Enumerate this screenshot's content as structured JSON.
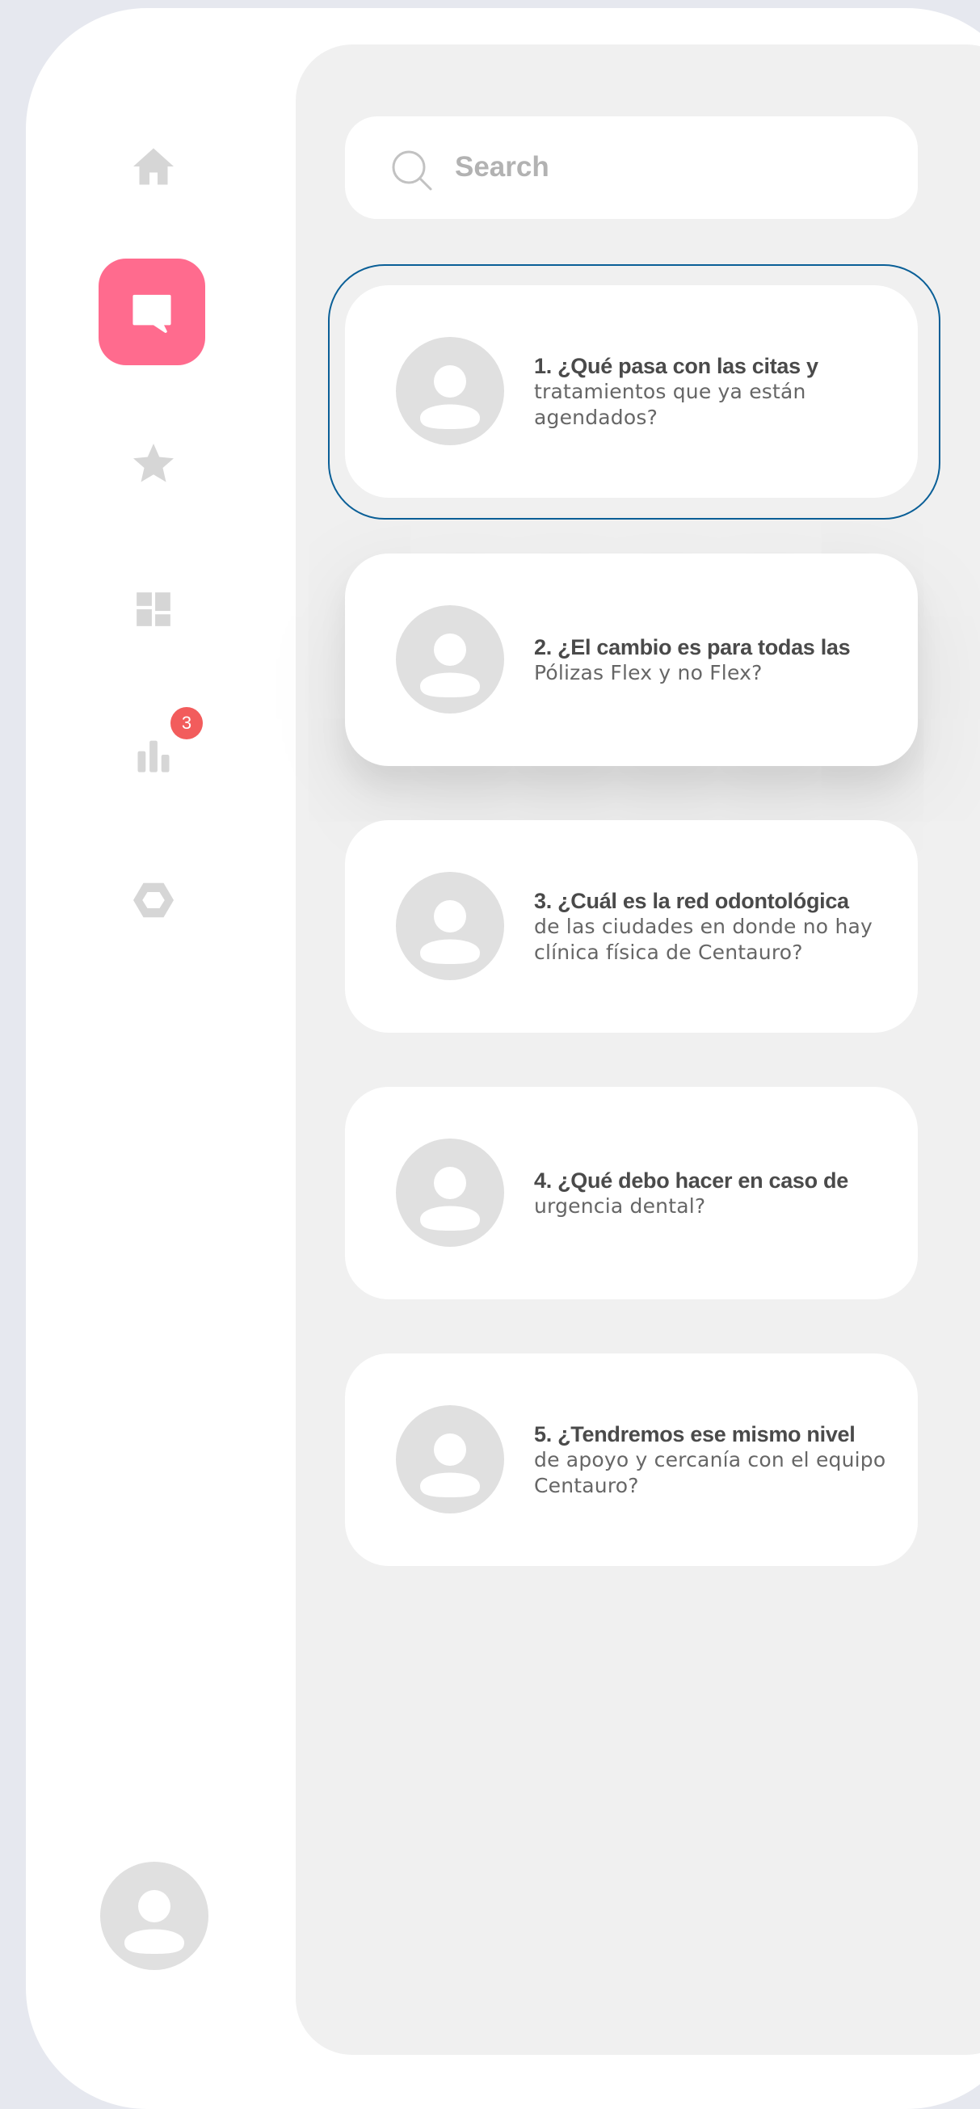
{
  "search": {
    "placeholder": "Search",
    "value": ""
  },
  "sidebar": {
    "items": [
      {
        "name": "home",
        "icon": "home-icon",
        "active": false
      },
      {
        "name": "messages",
        "icon": "message-icon",
        "active": true
      },
      {
        "name": "favorites",
        "icon": "star-icon",
        "active": false
      },
      {
        "name": "dashboard",
        "icon": "dashboard-icon",
        "active": false
      },
      {
        "name": "stats",
        "icon": "bar-chart-icon",
        "active": false,
        "badge": "3"
      },
      {
        "name": "settings",
        "icon": "hexagon-icon",
        "active": false
      }
    ],
    "badge_count": "3"
  },
  "questions": [
    {
      "title": "1. ¿Qué pasa con las citas y",
      "body": "tratamientos que ya están agendados?",
      "focused": true
    },
    {
      "title": "2. ¿El cambio es para todas las",
      "body": "Pólizas Flex y no Flex?",
      "hovered": true
    },
    {
      "title": "3. ¿Cuál es la red odontológica",
      "body": "de las ciudades en donde no hay clínica física de Centauro?"
    },
    {
      "title": "4. ¿Qué debo hacer en caso de",
      "body": "urgencia dental?"
    },
    {
      "title": "5. ¿Tendremos ese mismo nivel",
      "body": "de apoyo y cercanía con el equipo Centauro?"
    }
  ],
  "colors": {
    "accent": "#ff6b8e",
    "badge": "#f25c5c",
    "focus_ring": "#0a5f97",
    "panel": "#f0f0f0",
    "icon_gray": "#d6d6d6"
  }
}
